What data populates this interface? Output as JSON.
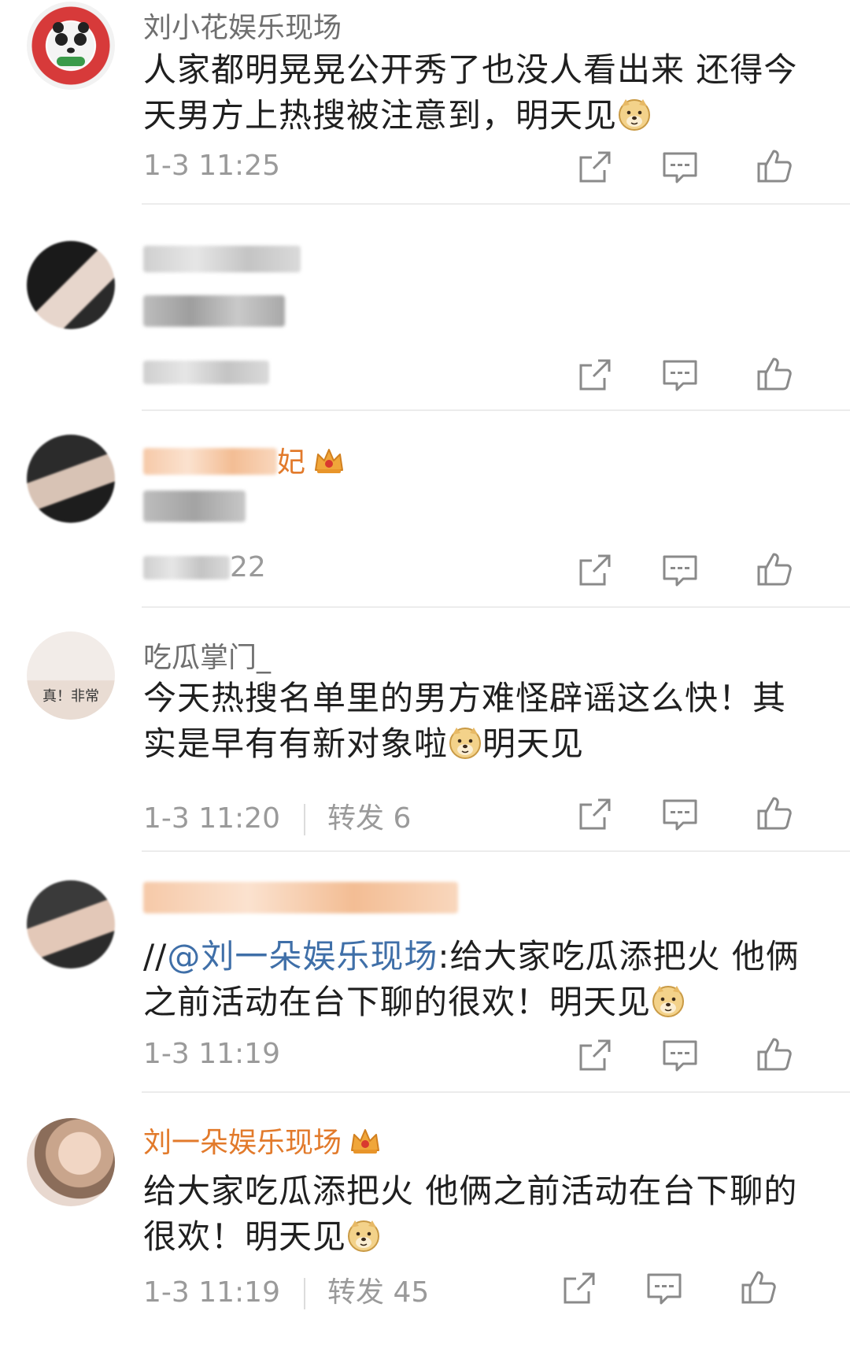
{
  "comments": [
    {
      "username": "刘小花娱乐现场",
      "text_before": "人家都明晃晃公开秀了也没人看出来 还得今天男方上热搜被注意到，明天见",
      "time": "1-3 11:25"
    },
    {
      "username": "",
      "text": "",
      "time": ""
    },
    {
      "username_tail": "妃",
      "text": "",
      "time_tail": "22"
    },
    {
      "username": "吃瓜掌门_",
      "text_before": "今天热搜名单里的男方难怪辟谣这么快！其实是早有有新对象啦",
      "text_after": "明天见",
      "time": "1-3 11:20",
      "repost": "转发 6",
      "avatar_caption": "真！非常"
    },
    {
      "username": "",
      "prefix": "//",
      "mention": "@刘一朵娱乐现场",
      "text_before": ":给大家吃瓜添把火 他俩之前活动在台下聊的很欢！明天见",
      "time": "1-3 11:19"
    },
    {
      "username": "刘一朵娱乐现场",
      "text_before": "给大家吃瓜添把火 他俩之前活动在台下聊的很欢！明天见",
      "time": "1-3 11:19",
      "repost": "转发 45"
    }
  ],
  "icons": {
    "share": "share-icon",
    "comment": "comment-icon",
    "like": "like-icon",
    "doge": "doge-emoji-icon",
    "crown": "vip-crown-icon"
  },
  "colors": {
    "vip_name": "#e27a2b",
    "mention": "#3f6fa8",
    "meta": "#9a9a9a",
    "text": "#1f1f1f"
  }
}
